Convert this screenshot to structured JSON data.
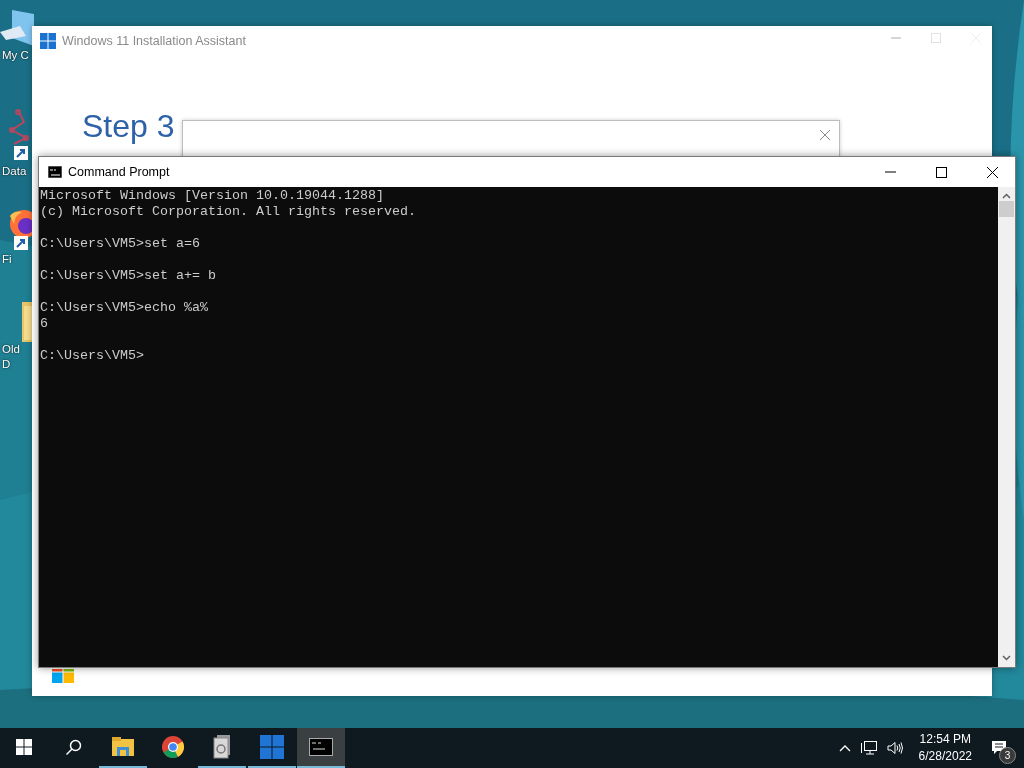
{
  "desktop_icons": [
    {
      "kind": "computer",
      "label_lines": [
        "My C"
      ]
    },
    {
      "kind": "data-app",
      "label_lines": [
        "Data"
      ]
    },
    {
      "kind": "firefox",
      "label_lines": [
        "Fi"
      ]
    },
    {
      "kind": "folder",
      "label_lines": [
        "Old",
        "D"
      ]
    }
  ],
  "assistant_window": {
    "title": "Windows 11 Installation Assistant",
    "heading": "Step 3"
  },
  "cmd_window": {
    "title": "Command Prompt",
    "console_blocks": [
      [
        "Microsoft Windows [Version 10.0.19044.1288]",
        "(c) Microsoft Corporation. All rights reserved."
      ],
      [
        "C:\\Users\\VM5>set a=6"
      ],
      [
        "C:\\Users\\VM5>set a+= b"
      ],
      [
        "C:\\Users\\VM5>echo %a%",
        "6"
      ],
      [
        "C:\\Users\\VM5>"
      ]
    ]
  },
  "taskbar": {
    "apps": [
      {
        "kind": "start",
        "running": false,
        "active": false
      },
      {
        "kind": "search",
        "running": false,
        "active": false
      },
      {
        "kind": "explorer",
        "running": true,
        "active": false
      },
      {
        "kind": "chrome",
        "running": false,
        "active": false
      },
      {
        "kind": "documents",
        "running": true,
        "active": false
      },
      {
        "kind": "win11",
        "running": true,
        "active": false
      },
      {
        "kind": "cmd",
        "running": true,
        "active": true
      }
    ],
    "clock_time": "12:54 PM",
    "clock_date": "6/28/2022",
    "notification_count": "3"
  }
}
